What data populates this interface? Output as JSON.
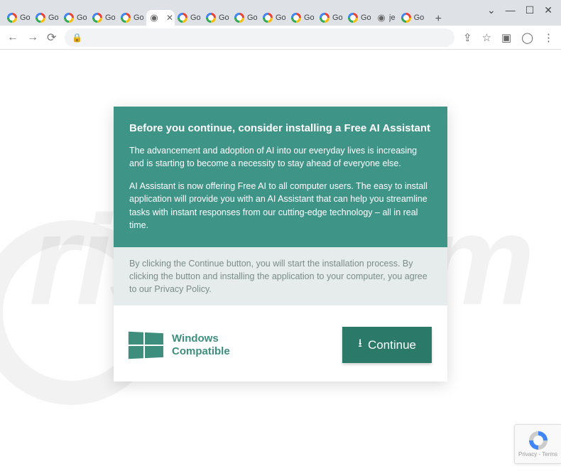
{
  "window": {
    "minimize": "—",
    "maximize": "☐",
    "close": "✕",
    "chevron": "⌄"
  },
  "tabs": {
    "items": [
      {
        "type": "google",
        "label": "Go"
      },
      {
        "type": "google",
        "label": "Go"
      },
      {
        "type": "google",
        "label": "Go"
      },
      {
        "type": "google",
        "label": "Go"
      },
      {
        "type": "google",
        "label": "Go"
      },
      {
        "type": "globe",
        "label": "",
        "active": true
      },
      {
        "type": "google",
        "label": "Go"
      },
      {
        "type": "google",
        "label": "Go"
      },
      {
        "type": "google",
        "label": "Go"
      },
      {
        "type": "google",
        "label": "Go"
      },
      {
        "type": "google",
        "label": "Go"
      },
      {
        "type": "google",
        "label": "Go"
      },
      {
        "type": "google",
        "label": "Go"
      },
      {
        "type": "globe",
        "label": "je"
      },
      {
        "type": "google",
        "label": "Go"
      }
    ],
    "newtab": "+"
  },
  "toolbar": {
    "back": "←",
    "forward": "→",
    "reload": "⟳",
    "lock": "🔒",
    "share": "⇪",
    "star": "☆",
    "sidepanel": "▣",
    "account": "◯",
    "menu": "⋮"
  },
  "dialog": {
    "title": "Before you continue, consider installing a Free AI Assistant",
    "para1": "The advancement and adoption of AI into our everyday lives is increasing and is starting to become a necessity to stay ahead of everyone else.",
    "para2": "AI Assistant is now offering Free AI to all computer users. The easy to install application will provide you with an AI Assistant that can help you streamline tasks with instant responses from our cutting-edge technology – all in real time.",
    "disclaimer": "By clicking the Continue button, you will start the installation process. By clicking the button and installing the application to your computer, you agree to our Privacy Policy.",
    "compat_line1": "Windows",
    "compat_line2": "Compatible",
    "continue": "Continue"
  },
  "recaptcha": {
    "line": "Privacy - Terms"
  },
  "watermark": "risk.com"
}
